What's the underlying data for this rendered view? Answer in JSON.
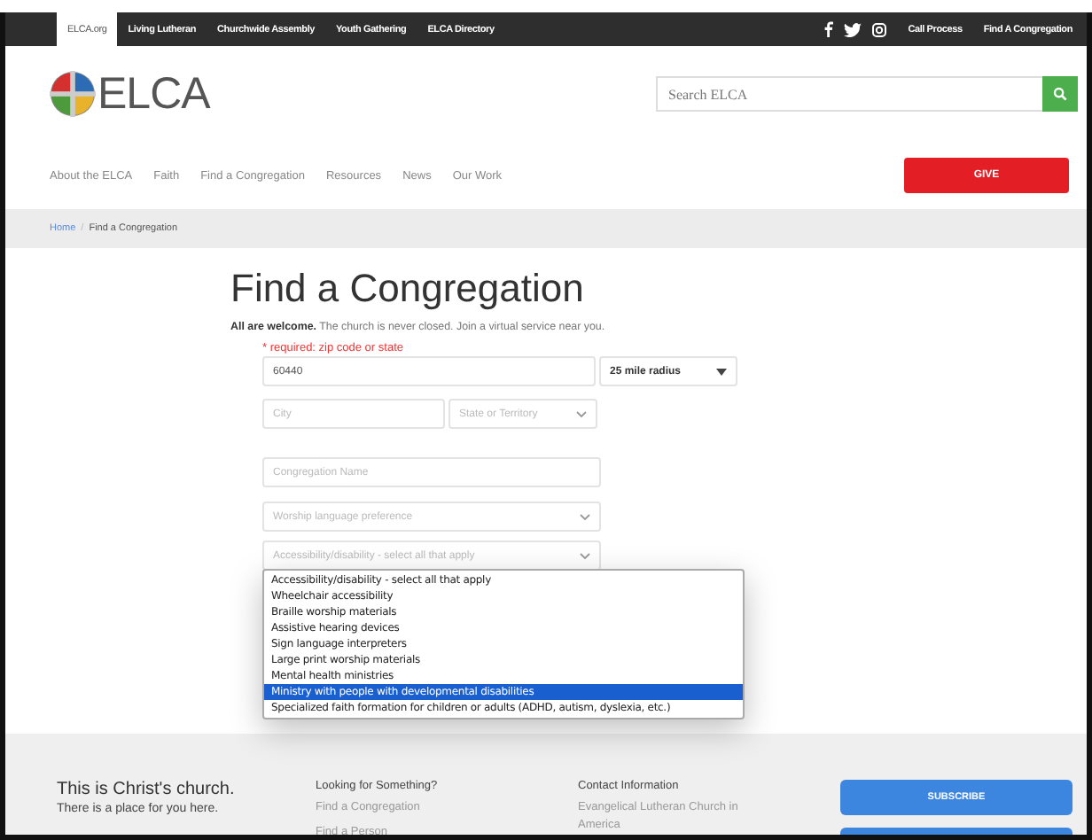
{
  "top_bar": {
    "tabs": [
      {
        "label": "ELCA.org",
        "selected": true
      },
      {
        "label": "Living Lutheran",
        "selected": false
      },
      {
        "label": "Churchwide Assembly",
        "selected": false
      },
      {
        "label": "Youth Gathering",
        "selected": false
      },
      {
        "label": "ELCA Directory",
        "selected": false
      }
    ],
    "links": [
      "Call Process",
      "Find A Congregation"
    ]
  },
  "header": {
    "logo_text": "ELCA",
    "search": {
      "placeholder": "Search ELCA"
    }
  },
  "nav": {
    "items": [
      "About the ELCA",
      "Faith",
      "Find a Congregation",
      "Resources",
      "News",
      "Our Work"
    ],
    "give_button": "GIVE"
  },
  "breadcrumb": {
    "home": "Home",
    "separator": "/",
    "current": "Find a Congregation"
  },
  "form": {
    "title": "Find a Congregation",
    "intro": "**All are welcome.** The church is never closed. Join a virtual service near you.",
    "required_note": "* required: zip code or state",
    "zip": {
      "value": "60440"
    },
    "radius": {
      "value": "25 mile radius"
    },
    "city": {
      "placeholder": "City"
    },
    "state": {
      "placeholder": "State or Territory"
    },
    "congregation_name": {
      "placeholder": "Congregation Name"
    },
    "worship_language": {
      "placeholder": "Worship language preference"
    },
    "accessibility": {
      "placeholder": "Accessibility/disability - select all that apply",
      "expanded": true,
      "options": [
        {
          "label": "Accessibility/disability - select all that apply",
          "selected": false
        },
        {
          "label": "Wheelchair accessibility",
          "selected": false
        },
        {
          "label": "Braille worship materials",
          "selected": false
        },
        {
          "label": "Assistive hearing devices",
          "selected": false
        },
        {
          "label": "Sign language interpreters",
          "selected": false
        },
        {
          "label": "Large print worship materials",
          "selected": false
        },
        {
          "label": "Mental health ministries",
          "selected": false
        },
        {
          "label": "Ministry with people with developmental disabilities",
          "selected": true
        },
        {
          "label": "Specialized faith formation for children or adults (ADHD, autism, dyslexia, etc.)",
          "selected": false
        }
      ]
    }
  },
  "footer": {
    "tagline": "This is Christ's church.",
    "subtagline": "There is a place for you here.",
    "columns": [
      {
        "heading": "Looking for Something?",
        "links": [
          "Find a Congregation",
          "Find a Person"
        ]
      },
      {
        "heading": "Contact Information",
        "links": [
          "Evangelical Lutheran Church in America"
        ]
      }
    ],
    "subscribe_button": "SUBSCRIBE"
  }
}
